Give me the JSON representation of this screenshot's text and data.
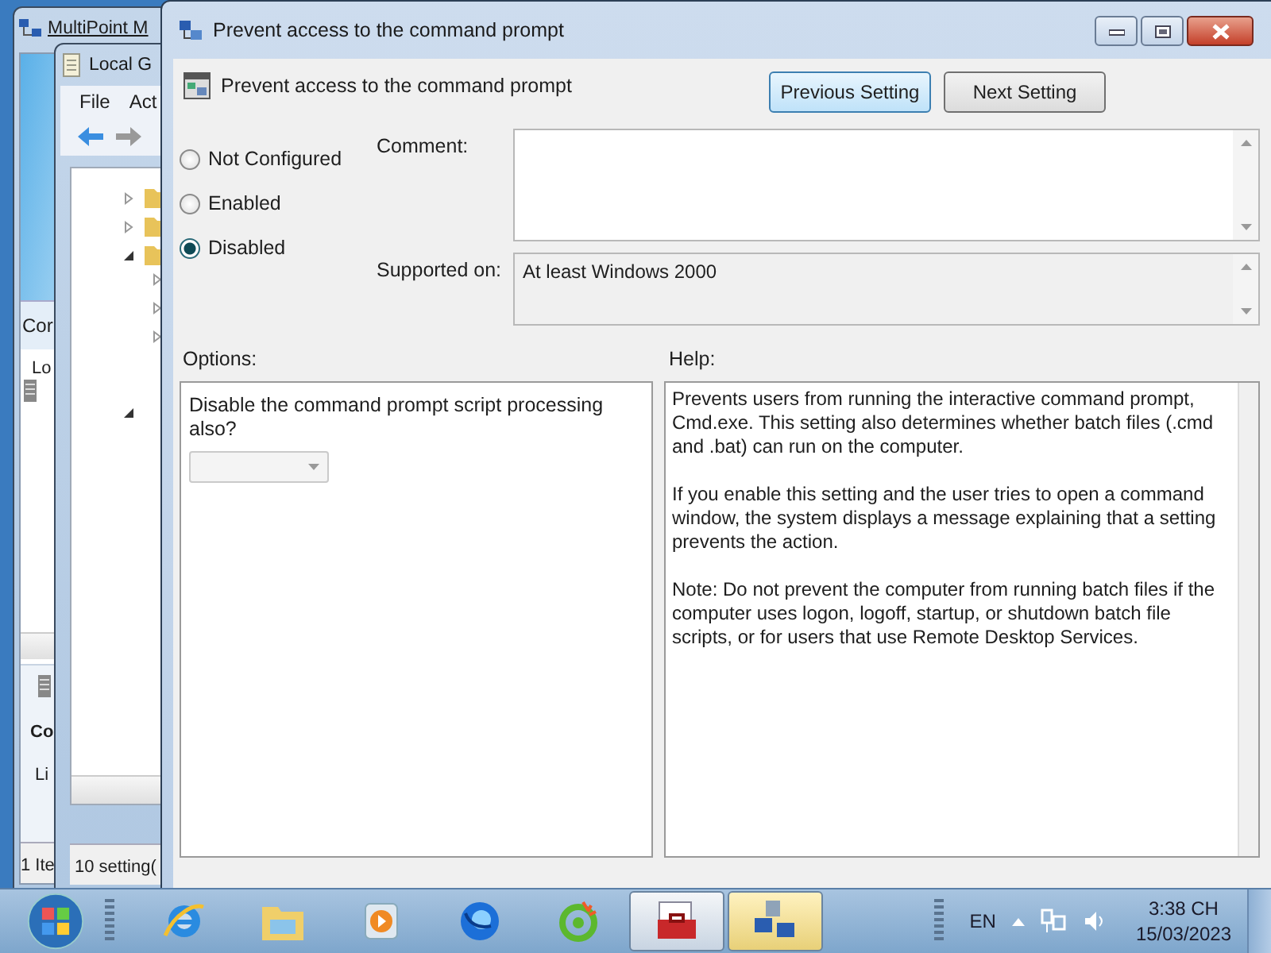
{
  "background_windows": [
    {
      "kind": "manager",
      "title": "MultiPoint M",
      "texts": [
        "Cor",
        "Lo"
      ],
      "detail_title": "Co",
      "detail_text": "Li",
      "status": "1 Ite"
    },
    {
      "kind": "editor",
      "title": "Local G",
      "menu": [
        "File",
        "Act"
      ],
      "status": "10 setting("
    }
  ],
  "dialog": {
    "title": "Prevent access to the command prompt",
    "header": "Prevent access to the command prompt",
    "nav_buttons": [
      {
        "label": "Previous Setting",
        "hover": true
      },
      {
        "label": "Next Setting",
        "hover": false
      }
    ],
    "states": [
      {
        "label": "Not Configured",
        "selected": false
      },
      {
        "label": "Enabled",
        "selected": false
      },
      {
        "label": "Disabled",
        "selected": true
      }
    ],
    "comment_label": "Comment:",
    "supported_label": "Supported on:",
    "supported_value": "At least Windows 2000",
    "options_label": "Options:",
    "help_label": "Help:",
    "option_text": "Disable the command prompt script processing also?",
    "option_dropdown": {
      "disabled": true
    },
    "help": [
      "Prevents users from running the interactive command prompt, Cmd.exe. This setting also determines whether batch files (.cmd and .bat) can run on the computer.",
      "If you enable this setting and the user tries to open a command window, the system displays a message explaining that a setting prevents the action.",
      "Note: Do not prevent the computer from running batch files if the computer uses logon, logoff, startup, or shutdown batch file scripts, or for users that use Remote Desktop Services."
    ]
  },
  "taskbar": {
    "apps": [
      {
        "kind": "ie",
        "selected": false
      },
      {
        "kind": "folder",
        "selected": false
      },
      {
        "kind": "player",
        "selected": false
      },
      {
        "kind": "browser",
        "selected": false
      },
      {
        "kind": "coccoc",
        "selected": false
      },
      {
        "kind": "toolbox",
        "selected": true
      },
      {
        "kind": "network",
        "selected": true
      }
    ],
    "language": "EN",
    "time": "3:38 CH",
    "date": "15/03/2023"
  }
}
